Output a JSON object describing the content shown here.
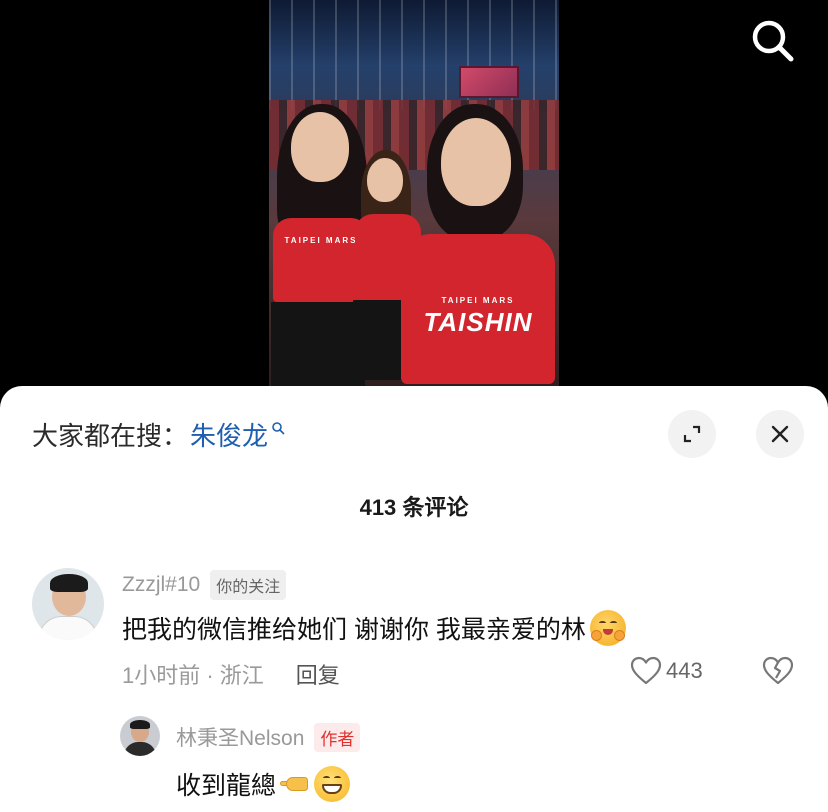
{
  "search_bar": {
    "prefix": "大家都在搜：",
    "term": "朱俊龙"
  },
  "video": {
    "jersey_small": "TAIPEI MARS",
    "jersey_big": "TAISHIN"
  },
  "comments_header": {
    "count_label": "413 条评论"
  },
  "comment": {
    "username": "Zzzjl#10",
    "follow_badge": "你的关注",
    "text": "把我的微信推给她们 谢谢你 我最亲爱的林",
    "time_location": "1小时前 · 浙江",
    "reply_label": "回复",
    "likes": "443"
  },
  "reply": {
    "username": "林秉圣Nelson",
    "author_badge": "作者",
    "text": "收到龍總"
  },
  "colors": {
    "accent_link": "#1f5fb0",
    "author_badge": "#e0312f",
    "jersey_red": "#d2252d"
  }
}
